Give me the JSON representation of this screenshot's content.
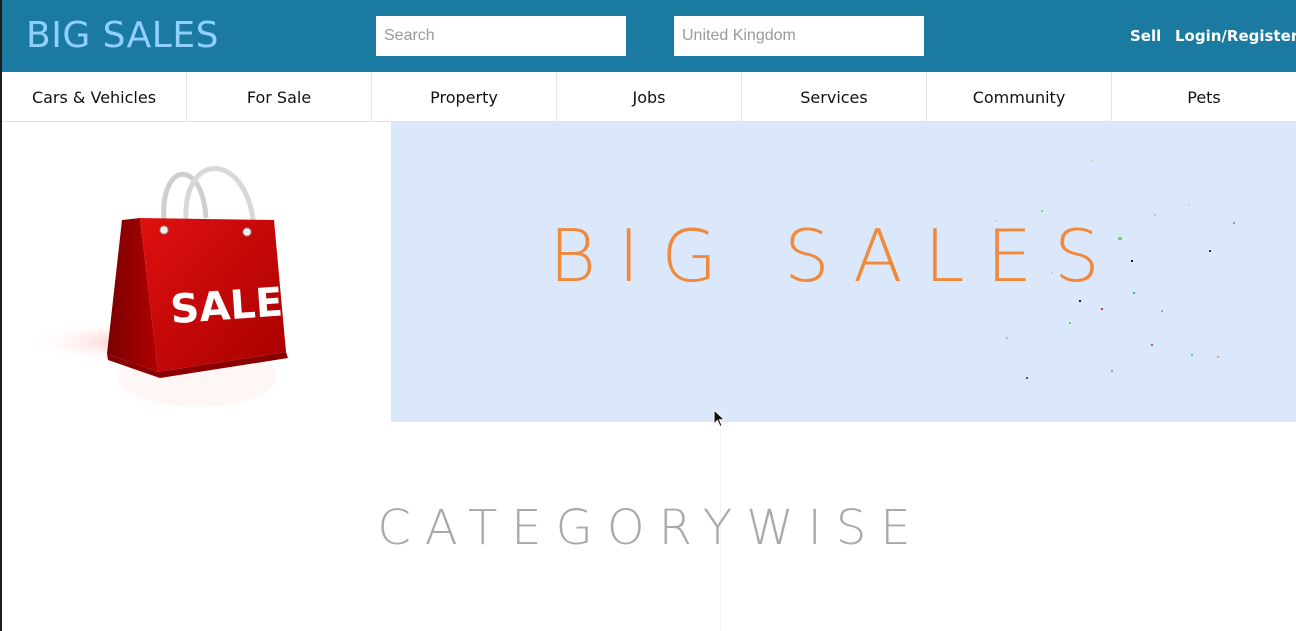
{
  "header": {
    "brand": "BIG SALES",
    "search_placeholder": "Search",
    "location_placeholder": "United Kingdom",
    "sell_label": "Sell",
    "login_label": "Login/Register",
    "background_color": "#1b7aa0"
  },
  "nav": {
    "items": [
      {
        "label": "Cars & Vehicles"
      },
      {
        "label": "For Sale"
      },
      {
        "label": "Property"
      },
      {
        "label": "Jobs"
      },
      {
        "label": "Services"
      },
      {
        "label": "Community"
      },
      {
        "label": "Pets"
      }
    ]
  },
  "hero": {
    "image_icon": "shopping-bag-icon",
    "bag_text": "SALE",
    "banner_title": "BIG SALES",
    "banner_color": "#dbe8fb",
    "title_color": "#f0893c"
  },
  "section": {
    "title": "CATEGORYWISE"
  }
}
